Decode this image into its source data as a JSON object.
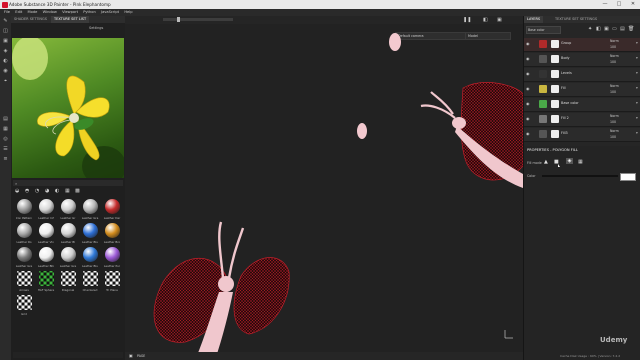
{
  "window": {
    "title": "Adobe Substance 3D Painter - Pink Elephantomp",
    "controls": [
      "—",
      "□",
      "✕"
    ]
  },
  "menu": [
    "File",
    "Edit",
    "Mode",
    "Window",
    "Viewport",
    "Python",
    "JavaScript",
    "Help"
  ],
  "left_panel": {
    "tabs": [
      "SHADER SETTINGS",
      "TEXTURE SET LIST"
    ],
    "settings_label": "Settings"
  },
  "shelf": {
    "search_placeholder": "",
    "items": [
      {
        "label": "Iron Pattern",
        "color": "#9c9c9c"
      },
      {
        "label": "Leather Inf",
        "color": "#d7d7d7"
      },
      {
        "label": "Leather Gr",
        "color": "#cfcfcf"
      },
      {
        "label": "Leather Gra",
        "color": "#b7b7b7"
      },
      {
        "label": "Leather Dar",
        "color": "#c62b2b"
      },
      {
        "label": "Leather Ro",
        "color": "#aaaaaa"
      },
      {
        "label": "Leather Vin",
        "color": "#eeeeee"
      },
      {
        "label": "Leather Bl",
        "color": "#d5d5d5"
      },
      {
        "label": "Leather Blu",
        "color": "#2d6fd6"
      },
      {
        "label": "Leather Bro",
        "color": "#d38c1c"
      },
      {
        "label": "Leather Gre",
        "color": "#7b7b7b"
      },
      {
        "label": "Leather Blk",
        "color": "#efefef"
      },
      {
        "label": "Leather Gre",
        "color": "#cfcfcf"
      },
      {
        "label": "Leather Blu",
        "color": "#2f79d8"
      },
      {
        "label": "Leather Pur",
        "color": "#9b59d6"
      },
      {
        "label": "Arrows",
        "color": "#f5f5f5"
      },
      {
        "label": "HAF Sphere",
        "color": "#3cb53c"
      },
      {
        "label": "Diagonal",
        "color": "#f5f5f5"
      },
      {
        "label": "Checkered",
        "color": "#f5f5f5"
      },
      {
        "label": "Tri Plane",
        "color": "#f5f5f5"
      },
      {
        "label": "Grid",
        "color": "#f5f5f5"
      }
    ]
  },
  "viewport": {
    "camera": "Default camera",
    "mode": "Model",
    "bottom_label": "PAGE"
  },
  "right_panel": {
    "tabs": [
      "LAYERS",
      "TEXTURE SET SETTINGS"
    ],
    "top_select": "Base color",
    "layers": [
      {
        "name": "Group",
        "blend": "Norm",
        "opacity": "100",
        "thumb_color": "#b02a2a",
        "selected": true
      },
      {
        "name": "Body",
        "blend": "Norm",
        "opacity": "100",
        "thumb_color": "#555555",
        "selected": false
      },
      {
        "name": "Levels",
        "blend": "",
        "opacity": "",
        "thumb_color": "#333333",
        "selected": false
      },
      {
        "name": "Fill",
        "blend": "Norm",
        "opacity": "100",
        "thumb_color": "#c9b640",
        "selected": false
      },
      {
        "name": "Base color",
        "blend": "",
        "opacity": "",
        "thumb_color": "#4aa848",
        "selected": false
      },
      {
        "name": "Fill 2",
        "blend": "Norm",
        "opacity": "100",
        "thumb_color": "#777777",
        "selected": false
      },
      {
        "name": "Fill3",
        "blend": "Norm",
        "opacity": "100",
        "thumb_color": "#555555",
        "selected": false
      }
    ],
    "properties": {
      "title": "PROPERTIES - POLYGON FILL",
      "fill_mode_label": "Fill mode",
      "color_label": "Color"
    }
  },
  "footer": {
    "cache": "Cache Disk Usage : 60% | Version: 7.2.2"
  },
  "watermark": "Udemy",
  "colors": {
    "accent_red": "#c32a2a",
    "petal_yellow": "#ffdc2d",
    "pink": "#f0c7cd"
  }
}
